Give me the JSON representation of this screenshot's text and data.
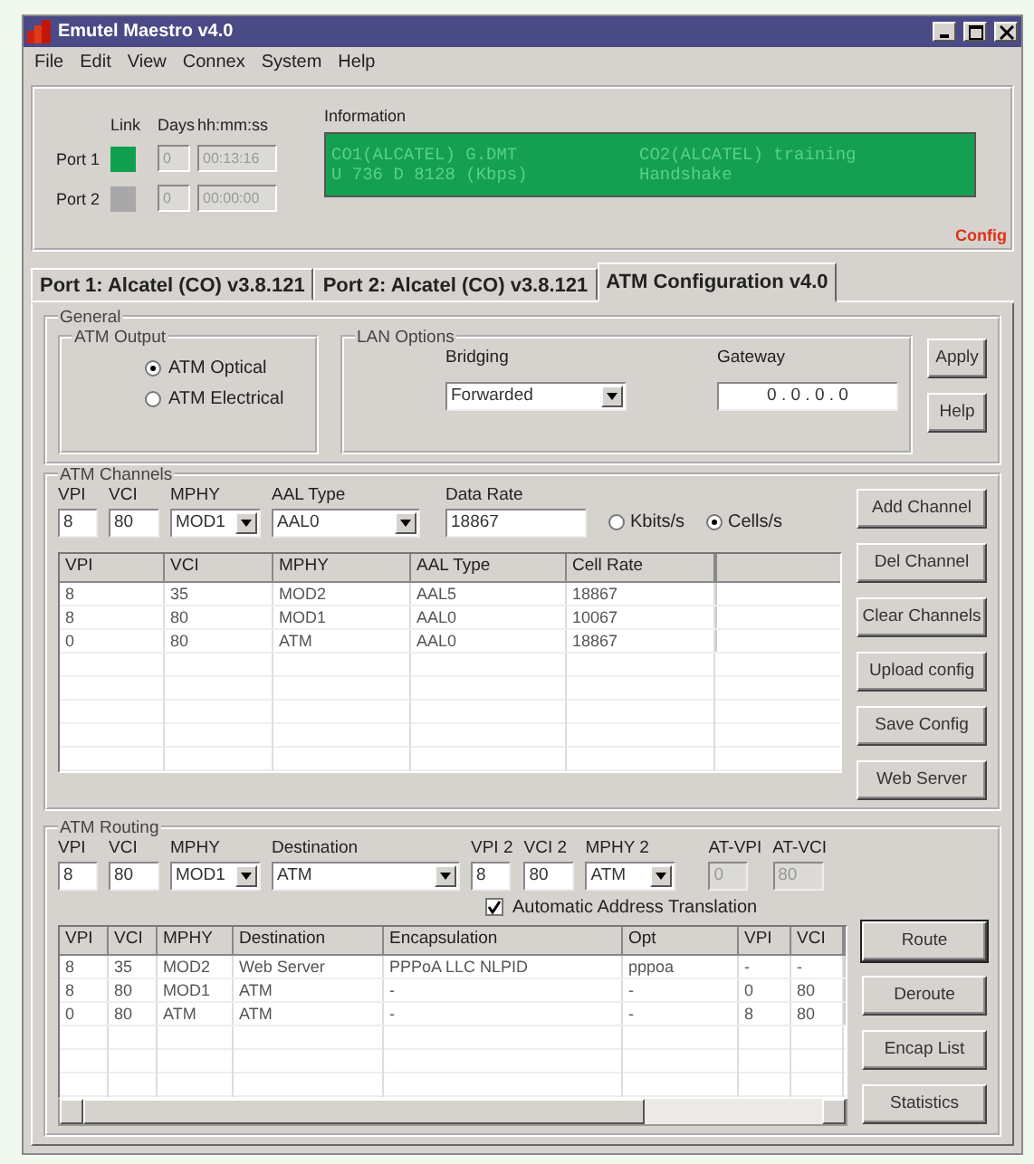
{
  "window": {
    "title": "Emutel Maestro v4.0"
  },
  "menu": [
    "File",
    "Edit",
    "View",
    "Connex",
    "System",
    "Help"
  ],
  "status": {
    "headers": {
      "link": "Link",
      "days": "Days",
      "time": "hh:mm:ss",
      "information": "Information"
    },
    "ports": [
      {
        "label": "Port 1",
        "color": "#10a050",
        "days": "0",
        "time": "00:13:16"
      },
      {
        "label": "Port 2",
        "color": "#a8a8a8",
        "days": "0",
        "time": "00:00:00"
      }
    ],
    "information": [
      [
        "CO1(ALCATEL) G.DMT",
        "CO2(ALCATEL) training"
      ],
      [
        "U 736 D 8128 (Kbps)",
        "Handshake"
      ]
    ],
    "config_link": "Config"
  },
  "tabs": [
    {
      "label": "Port 1: Alcatel (CO) v3.8.121",
      "selected": false
    },
    {
      "label": "Port 2: Alcatel (CO) v3.8.121",
      "selected": false
    },
    {
      "label": "ATM Configuration v4.0",
      "selected": true
    }
  ],
  "general": {
    "title": "General",
    "atm_output": {
      "title": "ATM Output",
      "options": [
        {
          "label": "ATM Optical",
          "selected": true
        },
        {
          "label": "ATM Electrical",
          "selected": false
        }
      ]
    },
    "lan_options": {
      "title": "LAN Options",
      "bridging": {
        "label": "Bridging",
        "value": "Forwarded"
      },
      "gateway": {
        "label": "Gateway",
        "value": "0 . 0 . 0 . 0"
      }
    },
    "buttons": [
      "Apply",
      "Help"
    ]
  },
  "channels": {
    "title": "ATM Channels",
    "fields": [
      {
        "kind": "text",
        "label": "VPI",
        "value": "8"
      },
      {
        "kind": "text",
        "label": "VCI",
        "value": "80"
      },
      {
        "kind": "select",
        "label": "MPHY",
        "value": "MOD1"
      },
      {
        "kind": "select",
        "label": "AAL Type",
        "value": "AAL0"
      },
      {
        "kind": "text",
        "label": "Data Rate",
        "value": "18867"
      }
    ],
    "units": [
      {
        "label": "Kbits/s",
        "selected": false
      },
      {
        "label": "Cells/s",
        "selected": true
      }
    ],
    "table": {
      "columns": [
        "VPI",
        "VCI",
        "MPHY",
        "AAL Type",
        "Cell Rate"
      ],
      "rows": [
        [
          "8",
          "35",
          "MOD2",
          "AAL5",
          "18867"
        ],
        [
          "8",
          "80",
          "MOD1",
          "AAL0",
          "10067"
        ],
        [
          "0",
          "80",
          "ATM",
          "AAL0",
          "18867"
        ]
      ]
    },
    "buttons": [
      "Add Channel",
      "Del Channel",
      "Clear Channels",
      "Upload config",
      "Save Config",
      "Web Server"
    ]
  },
  "routing": {
    "title": "ATM Routing",
    "fields": [
      {
        "kind": "text",
        "label": "VPI",
        "value": "8"
      },
      {
        "kind": "text",
        "label": "VCI",
        "value": "80"
      },
      {
        "kind": "select",
        "label": "MPHY",
        "value": "MOD1"
      },
      {
        "kind": "select",
        "label": "Destination",
        "value": "ATM"
      },
      {
        "kind": "text",
        "label": "VPI 2",
        "value": "8"
      },
      {
        "kind": "text",
        "label": "VCI 2",
        "value": "80"
      },
      {
        "kind": "select",
        "label": "MPHY 2",
        "value": "ATM"
      },
      {
        "kind": "text",
        "label": "AT-VPI",
        "value": "0",
        "disabled": true
      },
      {
        "kind": "text",
        "label": "AT-VCI",
        "value": "80",
        "disabled": true
      }
    ],
    "auto_translation": {
      "label": "Automatic Address Translation",
      "checked": true
    },
    "table": {
      "columns": [
        "VPI",
        "VCI",
        "MPHY",
        "Destination",
        "Encapsulation",
        "Opt",
        "VPI",
        "VCI"
      ],
      "rows": [
        [
          "8",
          "35",
          "MOD2",
          "Web Server",
          "PPPoA LLC NLPID",
          "pppoa",
          "-",
          "-"
        ],
        [
          "8",
          "80",
          "MOD1",
          "ATM",
          "-",
          "-",
          "0",
          "80"
        ],
        [
          "0",
          "80",
          "ATM",
          "ATM",
          "-",
          "-",
          "8",
          "80"
        ]
      ]
    },
    "buttons": [
      {
        "label": "Route",
        "default": true
      },
      {
        "label": "Deroute",
        "default": false
      },
      {
        "label": "Encap List",
        "default": false
      },
      {
        "label": "Statistics",
        "default": false
      }
    ]
  }
}
